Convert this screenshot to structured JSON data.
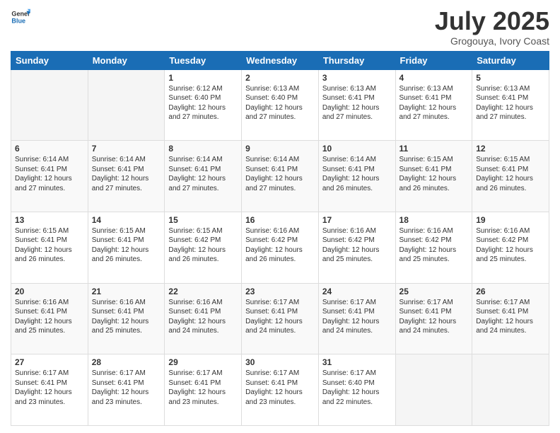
{
  "logo": {
    "line1": "General",
    "line2": "Blue"
  },
  "title": "July 2025",
  "location": "Grogouya, Ivory Coast",
  "days_of_week": [
    "Sunday",
    "Monday",
    "Tuesday",
    "Wednesday",
    "Thursday",
    "Friday",
    "Saturday"
  ],
  "weeks": [
    [
      null,
      null,
      {
        "day": 1,
        "sunrise": "6:12 AM",
        "sunset": "6:40 PM",
        "daylight": "12 hours and 27 minutes."
      },
      {
        "day": 2,
        "sunrise": "6:13 AM",
        "sunset": "6:40 PM",
        "daylight": "12 hours and 27 minutes."
      },
      {
        "day": 3,
        "sunrise": "6:13 AM",
        "sunset": "6:41 PM",
        "daylight": "12 hours and 27 minutes."
      },
      {
        "day": 4,
        "sunrise": "6:13 AM",
        "sunset": "6:41 PM",
        "daylight": "12 hours and 27 minutes."
      },
      {
        "day": 5,
        "sunrise": "6:13 AM",
        "sunset": "6:41 PM",
        "daylight": "12 hours and 27 minutes."
      }
    ],
    [
      {
        "day": 6,
        "sunrise": "6:14 AM",
        "sunset": "6:41 PM",
        "daylight": "12 hours and 27 minutes."
      },
      {
        "day": 7,
        "sunrise": "6:14 AM",
        "sunset": "6:41 PM",
        "daylight": "12 hours and 27 minutes."
      },
      {
        "day": 8,
        "sunrise": "6:14 AM",
        "sunset": "6:41 PM",
        "daylight": "12 hours and 27 minutes."
      },
      {
        "day": 9,
        "sunrise": "6:14 AM",
        "sunset": "6:41 PM",
        "daylight": "12 hours and 27 minutes."
      },
      {
        "day": 10,
        "sunrise": "6:14 AM",
        "sunset": "6:41 PM",
        "daylight": "12 hours and 26 minutes."
      },
      {
        "day": 11,
        "sunrise": "6:15 AM",
        "sunset": "6:41 PM",
        "daylight": "12 hours and 26 minutes."
      },
      {
        "day": 12,
        "sunrise": "6:15 AM",
        "sunset": "6:41 PM",
        "daylight": "12 hours and 26 minutes."
      }
    ],
    [
      {
        "day": 13,
        "sunrise": "6:15 AM",
        "sunset": "6:41 PM",
        "daylight": "12 hours and 26 minutes."
      },
      {
        "day": 14,
        "sunrise": "6:15 AM",
        "sunset": "6:41 PM",
        "daylight": "12 hours and 26 minutes."
      },
      {
        "day": 15,
        "sunrise": "6:15 AM",
        "sunset": "6:42 PM",
        "daylight": "12 hours and 26 minutes."
      },
      {
        "day": 16,
        "sunrise": "6:16 AM",
        "sunset": "6:42 PM",
        "daylight": "12 hours and 26 minutes."
      },
      {
        "day": 17,
        "sunrise": "6:16 AM",
        "sunset": "6:42 PM",
        "daylight": "12 hours and 25 minutes."
      },
      {
        "day": 18,
        "sunrise": "6:16 AM",
        "sunset": "6:42 PM",
        "daylight": "12 hours and 25 minutes."
      },
      {
        "day": 19,
        "sunrise": "6:16 AM",
        "sunset": "6:42 PM",
        "daylight": "12 hours and 25 minutes."
      }
    ],
    [
      {
        "day": 20,
        "sunrise": "6:16 AM",
        "sunset": "6:41 PM",
        "daylight": "12 hours and 25 minutes."
      },
      {
        "day": 21,
        "sunrise": "6:16 AM",
        "sunset": "6:41 PM",
        "daylight": "12 hours and 25 minutes."
      },
      {
        "day": 22,
        "sunrise": "6:16 AM",
        "sunset": "6:41 PM",
        "daylight": "12 hours and 24 minutes."
      },
      {
        "day": 23,
        "sunrise": "6:17 AM",
        "sunset": "6:41 PM",
        "daylight": "12 hours and 24 minutes."
      },
      {
        "day": 24,
        "sunrise": "6:17 AM",
        "sunset": "6:41 PM",
        "daylight": "12 hours and 24 minutes."
      },
      {
        "day": 25,
        "sunrise": "6:17 AM",
        "sunset": "6:41 PM",
        "daylight": "12 hours and 24 minutes."
      },
      {
        "day": 26,
        "sunrise": "6:17 AM",
        "sunset": "6:41 PM",
        "daylight": "12 hours and 24 minutes."
      }
    ],
    [
      {
        "day": 27,
        "sunrise": "6:17 AM",
        "sunset": "6:41 PM",
        "daylight": "12 hours and 23 minutes."
      },
      {
        "day": 28,
        "sunrise": "6:17 AM",
        "sunset": "6:41 PM",
        "daylight": "12 hours and 23 minutes."
      },
      {
        "day": 29,
        "sunrise": "6:17 AM",
        "sunset": "6:41 PM",
        "daylight": "12 hours and 23 minutes."
      },
      {
        "day": 30,
        "sunrise": "6:17 AM",
        "sunset": "6:41 PM",
        "daylight": "12 hours and 23 minutes."
      },
      {
        "day": 31,
        "sunrise": "6:17 AM",
        "sunset": "6:40 PM",
        "daylight": "12 hours and 22 minutes."
      },
      null,
      null
    ]
  ]
}
